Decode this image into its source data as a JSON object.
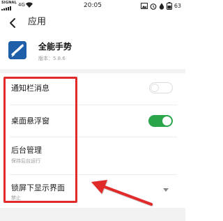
{
  "status_bar": {
    "carrier_label": "SIGNAL",
    "network_type": "4G",
    "time": "20:05",
    "battery_percent": "63",
    "icons": [
      "signal-icon",
      "wifi-icon",
      "photo-icon",
      "alarm-icon",
      "drop-icon",
      "battery-icon"
    ]
  },
  "header": {
    "back_icon": "back-arrow-icon",
    "title": "应用"
  },
  "app": {
    "icon": "app-logo-icon",
    "name": "全能手势",
    "version": "版本：5.8.6"
  },
  "settings": {
    "notification": {
      "label": "通知栏消息",
      "enabled": false
    },
    "floating_window": {
      "label": "桌面悬浮窗",
      "enabled": true
    },
    "background": {
      "label": "后台管理",
      "subtitle": "保持后台运行"
    },
    "lockscreen": {
      "label": "锁屏下显示界面",
      "subtitle": "禁止",
      "control_icon": "chevron-down-icon"
    }
  },
  "annotation": {
    "box_color": "#e12b2b",
    "arrow_color": "#e12b2b"
  },
  "colors": {
    "accent_green": "#2aa54a",
    "app_icon_blue": "#1f5ea8"
  }
}
